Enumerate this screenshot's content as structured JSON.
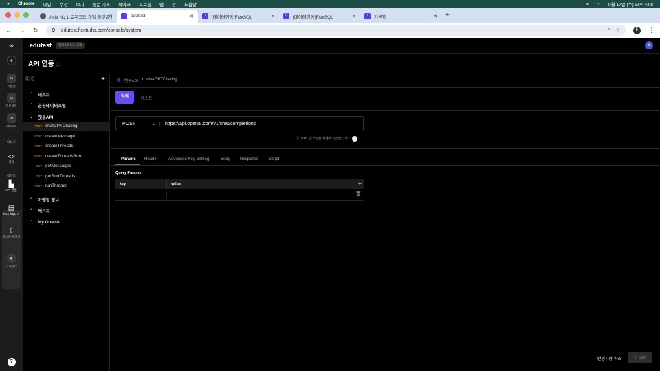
{
  "menubar": {
    "app": "Chrome",
    "items": [
      "파일",
      "수정",
      "보기",
      "방문 기록",
      "북마크",
      "프로필",
      "탭",
      "창",
      "도움말"
    ],
    "clock": "9월 17일 (수) 오후 4:08"
  },
  "browser": {
    "tabs": [
      {
        "title": "Asia No.1 로우코드 개발 플랫폼 |"
      },
      {
        "title": "edutest"
      },
      {
        "title": "[데이터연동]FlexSQL"
      },
      {
        "title": "[데이터연동]FlexSQL"
      },
      {
        "title": "기본앱"
      }
    ],
    "url": "edutest.flextudio.com/console/system",
    "profile": "F"
  },
  "rail": {
    "items": [
      {
        "label": "기본앱"
      },
      {
        "label": "프로젝트"
      },
      {
        "label": "edutest"
      },
      {
        "label": "더보기"
      },
      {
        "label": "개발"
      },
      {
        "label": "데이터"
      },
      {
        "label": "API 연동"
      },
      {
        "label": "Flex SQL"
      },
      {
        "label": "호스팅 올리기"
      },
      {
        "label": "고객관리"
      }
    ],
    "help": "?"
  },
  "header": {
    "workspace": "edutest",
    "badge": "워크스페이스 관리",
    "avatar": "B"
  },
  "page": {
    "title": "API 연동"
  },
  "tree": {
    "groups": [
      {
        "label": "테스트",
        "expanded": false
      },
      {
        "label": "공공데이터포털",
        "expanded": false
      },
      {
        "label": "챗봇API",
        "expanded": true,
        "items": [
          {
            "method": "POST",
            "name": "chatGPTChating"
          },
          {
            "method": "POST",
            "name": "createMessage"
          },
          {
            "method": "POST",
            "name": "createThreads"
          },
          {
            "method": "POST",
            "name": "createThreadsRun"
          },
          {
            "method": "GET",
            "name": "getMessages"
          },
          {
            "method": "GET",
            "name": "getRunThreads"
          },
          {
            "method": "POST",
            "name": "runThreads"
          }
        ]
      },
      {
        "label": "가맹점 정보",
        "expanded": false
      },
      {
        "label": "테스트",
        "expanded": false
      },
      {
        "label": "My OpenAI",
        "expanded": false
      }
    ]
  },
  "main": {
    "breadcrumb": [
      "챗봇API",
      "chatGPTChating"
    ],
    "mode_tabs": [
      "정의",
      "테스트"
    ],
    "method": "POST",
    "endpoint": "https://api.openai.com/v1/chat/completions",
    "encode_label": "URL 인코딩을 사용하시겠습니까?",
    "encode_on": false,
    "tabs": [
      "Params",
      "Header",
      "Advanced Key Setting",
      "Body",
      "Response",
      "Script"
    ],
    "active_tab": "Params",
    "query_title": "Query Params",
    "columns": [
      "key",
      "value"
    ],
    "rows": [
      {
        "key": "",
        "value": ""
      }
    ]
  },
  "footer": {
    "cancel": "변경사항 취소",
    "save": "배포"
  },
  "colors": {
    "accent": "#6c4cf0",
    "menubar": "#1e4d45",
    "post": "#e0902f",
    "get": "#4cae5a"
  }
}
